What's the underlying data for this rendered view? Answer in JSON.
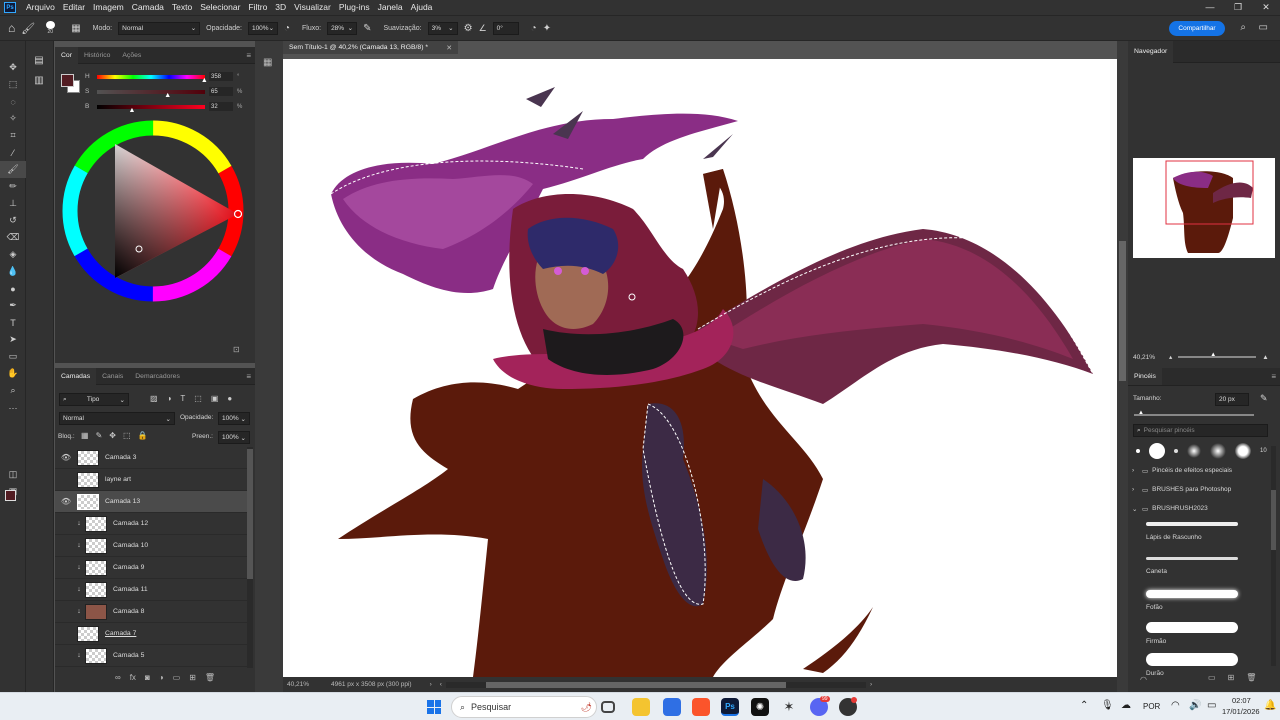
{
  "menu": [
    "Arquivo",
    "Editar",
    "Imagem",
    "Camada",
    "Texto",
    "Selecionar",
    "Filtro",
    "3D",
    "Visualizar",
    "Plug-ins",
    "Janela",
    "Ajuda"
  ],
  "options": {
    "brush_size": "20",
    "mode_label": "Modo:",
    "mode_value": "Normal",
    "opacity_label": "Opacidade:",
    "opacity_value": "100%",
    "flow_label": "Fluxo:",
    "flow_value": "28%",
    "smoothing_label": "Suavização:",
    "smoothing_value": "3%",
    "angle_value": "0°",
    "share_label": "Compartilhar"
  },
  "color_panel": {
    "tabs": [
      "Cor",
      "Histórico",
      "Ações"
    ],
    "sliders": [
      {
        "label": "H",
        "value": "358",
        "unit": "°",
        "fraction": 0.99
      },
      {
        "label": "S",
        "value": "65",
        "unit": "%",
        "fraction": 0.65
      },
      {
        "label": "B",
        "value": "32",
        "unit": "%",
        "fraction": 0.32
      }
    ],
    "foreground": "#521c22",
    "background": "#ffffff"
  },
  "layers_panel": {
    "tabs": [
      "Camadas",
      "Canais",
      "Demarcadores"
    ],
    "filter_label": "Tipo",
    "blend_mode": "Normal",
    "opacity_label": "Opacidade:",
    "opacity_value": "100%",
    "lock_label": "Bloq.:",
    "fill_label": "Preen.:",
    "fill_value": "100%",
    "layers": [
      {
        "name": "Camada 3",
        "visible": true,
        "clipped": false
      },
      {
        "name": "layne art",
        "visible": false,
        "clipped": false
      },
      {
        "name": "Camada 13",
        "visible": true,
        "clipped": false,
        "selected": true
      },
      {
        "name": "Camada 12",
        "visible": false,
        "clipped": true
      },
      {
        "name": "Camada 10",
        "visible": false,
        "clipped": true
      },
      {
        "name": "Camada 9",
        "visible": false,
        "clipped": true
      },
      {
        "name": "Camada 11",
        "visible": false,
        "clipped": true
      },
      {
        "name": "Camada 8",
        "visible": false,
        "clipped": true,
        "fill": "#8c5547"
      },
      {
        "name": "Camada 7",
        "visible": false,
        "clipped": false
      },
      {
        "name": "Camada 5",
        "visible": false,
        "clipped": true
      }
    ]
  },
  "document": {
    "tab_title": "Sem Título-1 @ 40,2% (Camada 13, RGB/8) *",
    "zoom": "40,21%",
    "size_info": "4961 px x 3508 px (300 ppi)"
  },
  "navigator": {
    "title": "Navegador",
    "zoom": "40,21%"
  },
  "brushes_panel": {
    "title": "Pincéis",
    "size_label": "Tamanho:",
    "size_value": "20 px",
    "search_placeholder": "Pesquisar pincéis",
    "preset_count": "10",
    "folders": [
      "Pincéis de efeitos especiais",
      "BRUSHES para Photoshop",
      "BRUSHRUSH2023"
    ],
    "brushes": [
      "Lápis de Rascunho",
      "Caneta",
      "Fofão",
      "Firmão",
      "Durão"
    ]
  },
  "taskbar": {
    "search_placeholder": "Pesquisar",
    "language": "POR",
    "time": "02:07",
    "date": "17/01/2026",
    "discord_badge": "99"
  },
  "colors": {
    "robe": "#5b1a0b",
    "cape": "#6e2745",
    "scarf": "#a3235a",
    "hair_smoke": "#8a2d85",
    "accent": "#1473e6"
  }
}
